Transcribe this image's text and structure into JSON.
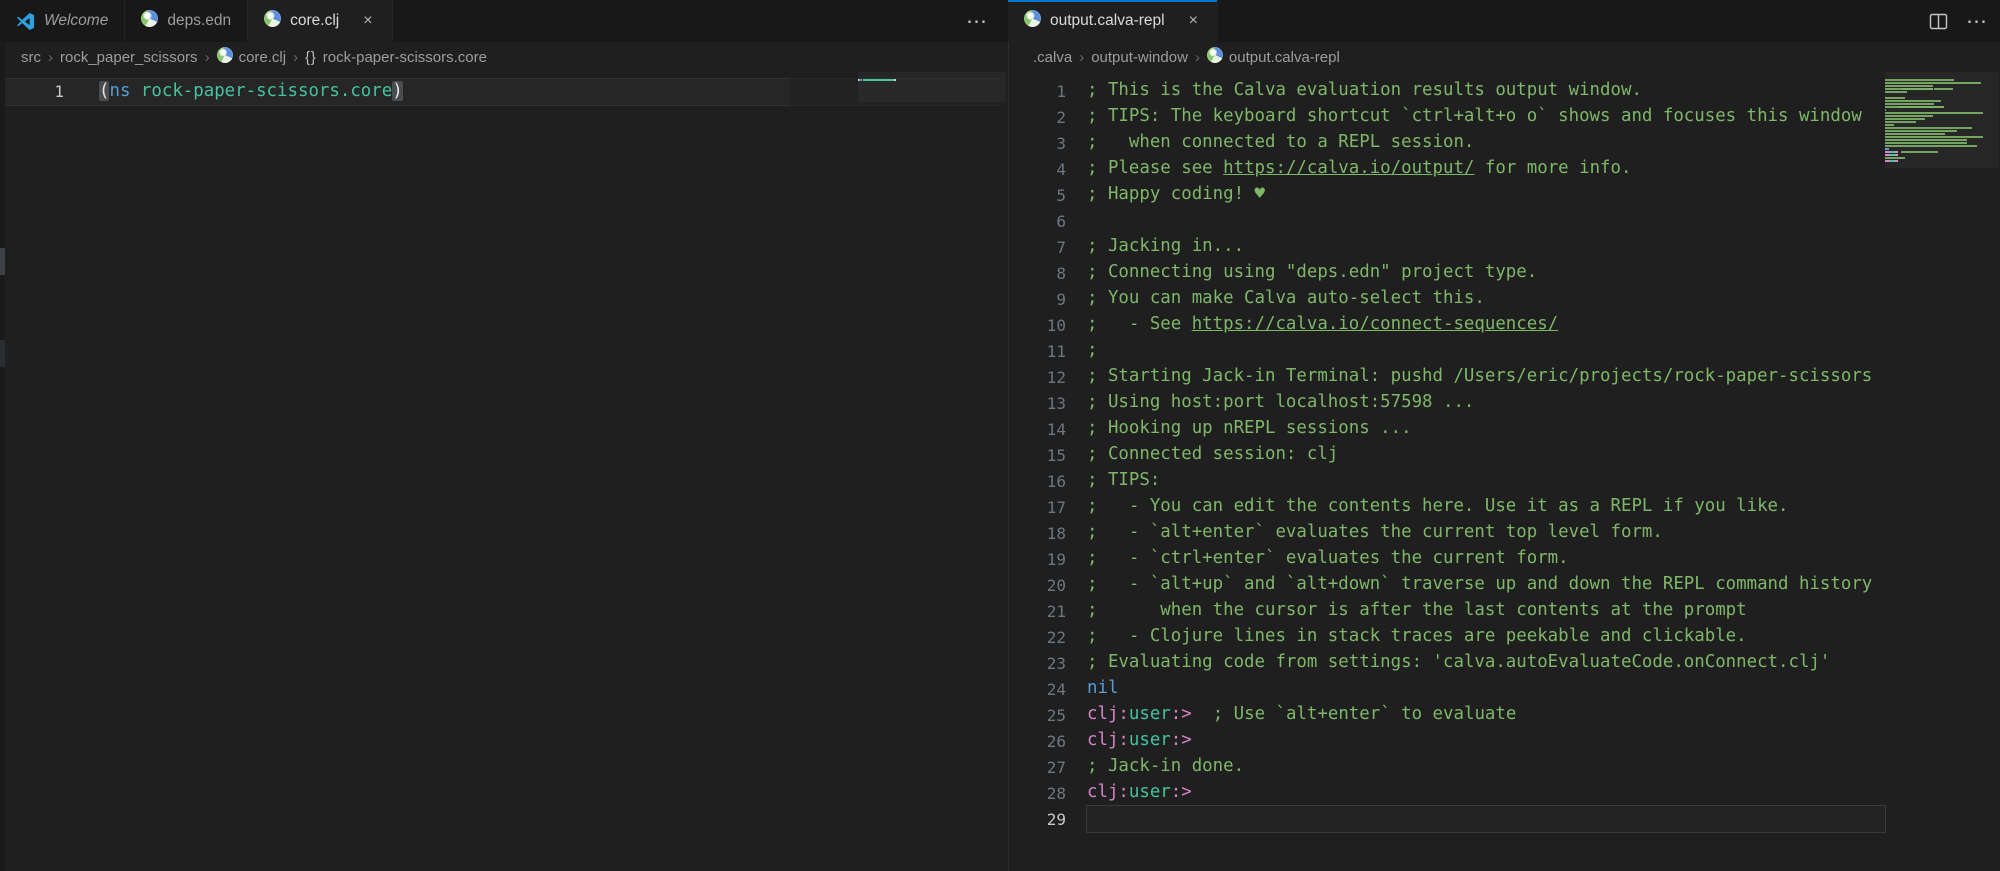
{
  "colors": {
    "accent_blue": "#0078d4",
    "editor_bg": "#1f1f1f",
    "tabbar_bg": "#181818",
    "comment_green": "#7fb769",
    "keyword_blue": "#569cd6",
    "teal": "#43c39e",
    "prompt_pink": "#d584c9"
  },
  "breadcrumb_separator": "›",
  "left_group": {
    "tabs": [
      {
        "label": "Welcome",
        "icon": "vscode-logo-icon",
        "active": false,
        "italic": true,
        "closable": false
      },
      {
        "label": "deps.edn",
        "icon": "calva-icon",
        "active": false,
        "italic": false,
        "closable": false
      },
      {
        "label": "core.clj",
        "icon": "calva-icon",
        "active": true,
        "italic": false,
        "closable": true,
        "close_label": "×"
      }
    ],
    "more_actions_label": "⋯",
    "breadcrumb": [
      {
        "label": "src"
      },
      {
        "label": "rock_paper_scissors"
      },
      {
        "label": "core.clj",
        "icon": "calva-icon"
      },
      {
        "label": "rock-paper-scissors.core",
        "icon": "braces-icon",
        "icon_glyph": "{}"
      }
    ],
    "editor": {
      "lines": [
        {
          "num": "1",
          "current": true,
          "segments": [
            {
              "text": "(",
              "style": "bracket"
            },
            {
              "text": "ns",
              "style": "keyword"
            },
            {
              "text": " ",
              "style": "plain"
            },
            {
              "text": "rock-paper-scissors.core",
              "style": "teal"
            },
            {
              "text": ")",
              "style": "bracket"
            }
          ]
        }
      ]
    }
  },
  "right_group": {
    "tab": {
      "label": "output.calva-repl",
      "icon": "calva-icon",
      "active": true,
      "close_label": "×"
    },
    "more_actions_label": "⋯",
    "breadcrumb": [
      {
        "label": ".calva"
      },
      {
        "label": "output-window"
      },
      {
        "label": "output.calva-repl",
        "icon": "calva-icon"
      }
    ],
    "editor": {
      "lines": [
        {
          "num": "1",
          "segments": [
            {
              "text": "; This is the Calva evaluation results output window.",
              "style": "comment"
            }
          ]
        },
        {
          "num": "2",
          "segments": [
            {
              "text": "; TIPS: The keyboard shortcut `ctrl+alt+o o` shows and focuses this window",
              "style": "comment"
            }
          ]
        },
        {
          "num": "3",
          "segments": [
            {
              "text": ";   when connected to a REPL session.",
              "style": "comment"
            }
          ]
        },
        {
          "num": "4",
          "segments": [
            {
              "text": "; Please see ",
              "style": "comment"
            },
            {
              "text": "https://calva.io/output/",
              "style": "link",
              "link_name": "link-calva-output"
            },
            {
              "text": " for more info.",
              "style": "comment"
            }
          ]
        },
        {
          "num": "5",
          "segments": [
            {
              "text": "; Happy coding! ♥",
              "style": "comment"
            }
          ]
        },
        {
          "num": "6",
          "segments": []
        },
        {
          "num": "7",
          "segments": [
            {
              "text": "; Jacking in...",
              "style": "comment"
            }
          ]
        },
        {
          "num": "8",
          "segments": [
            {
              "text": "; Connecting using \"deps.edn\" project type.",
              "style": "comment"
            }
          ]
        },
        {
          "num": "9",
          "segments": [
            {
              "text": "; You can make Calva auto-select this.",
              "style": "comment"
            }
          ]
        },
        {
          "num": "10",
          "segments": [
            {
              "text": ";   - See ",
              "style": "comment"
            },
            {
              "text": "https://calva.io/connect-sequences/",
              "style": "link",
              "link_name": "link-calva-connect-sequences"
            }
          ]
        },
        {
          "num": "11",
          "segments": [
            {
              "text": ";",
              "style": "comment"
            }
          ]
        },
        {
          "num": "12",
          "segments": [
            {
              "text": "; Starting Jack-in Terminal: pushd /Users/eric/projects/rock-paper-scissors",
              "style": "comment"
            }
          ]
        },
        {
          "num": "13",
          "segments": [
            {
              "text": "; Using host:port localhost:57598 ...",
              "style": "comment"
            }
          ]
        },
        {
          "num": "14",
          "segments": [
            {
              "text": "; Hooking up nREPL sessions ...",
              "style": "comment"
            }
          ]
        },
        {
          "num": "15",
          "segments": [
            {
              "text": "; Connected session: clj",
              "style": "comment"
            }
          ]
        },
        {
          "num": "16",
          "segments": [
            {
              "text": "; TIPS:",
              "style": "comment"
            }
          ]
        },
        {
          "num": "17",
          "segments": [
            {
              "text": ";   - You can edit the contents here. Use it as a REPL if you like.",
              "style": "comment"
            }
          ]
        },
        {
          "num": "18",
          "segments": [
            {
              "text": ";   - `alt+enter` evaluates the current top level form.",
              "style": "comment"
            }
          ]
        },
        {
          "num": "19",
          "segments": [
            {
              "text": ";   - `ctrl+enter` evaluates the current form.",
              "style": "comment"
            }
          ]
        },
        {
          "num": "20",
          "segments": [
            {
              "text": ";   - `alt+up` and `alt+down` traverse up and down the REPL command history",
              "style": "comment"
            }
          ]
        },
        {
          "num": "21",
          "segments": [
            {
              "text": ";      when the cursor is after the last contents at the prompt",
              "style": "comment"
            }
          ]
        },
        {
          "num": "22",
          "segments": [
            {
              "text": ";   - Clojure lines in stack traces are peekable and clickable.",
              "style": "comment"
            }
          ]
        },
        {
          "num": "23",
          "segments": [
            {
              "text": "; Evaluating code from settings: 'calva.autoEvaluateCode.onConnect.clj'",
              "style": "comment"
            }
          ]
        },
        {
          "num": "24",
          "segments": [
            {
              "text": "nil",
              "style": "keyword"
            }
          ]
        },
        {
          "num": "25",
          "segments": [
            {
              "text": "clj:",
              "style": "pink"
            },
            {
              "text": "user",
              "style": "teal"
            },
            {
              "text": ":>",
              "style": "pink"
            },
            {
              "text": "  ",
              "style": "plain"
            },
            {
              "text": "; Use `alt+enter` to evaluate",
              "style": "comment"
            }
          ]
        },
        {
          "num": "26",
          "segments": [
            {
              "text": "clj:",
              "style": "pink"
            },
            {
              "text": "user",
              "style": "teal"
            },
            {
              "text": ":>",
              "style": "pink"
            }
          ]
        },
        {
          "num": "27",
          "segments": [
            {
              "text": "; Jack-in done.",
              "style": "comment"
            }
          ]
        },
        {
          "num": "28",
          "segments": [
            {
              "text": "clj:",
              "style": "pink"
            },
            {
              "text": "user",
              "style": "teal"
            },
            {
              "text": ":>",
              "style": "pink"
            }
          ]
        },
        {
          "num": "29",
          "current": true,
          "segments": []
        }
      ]
    }
  }
}
